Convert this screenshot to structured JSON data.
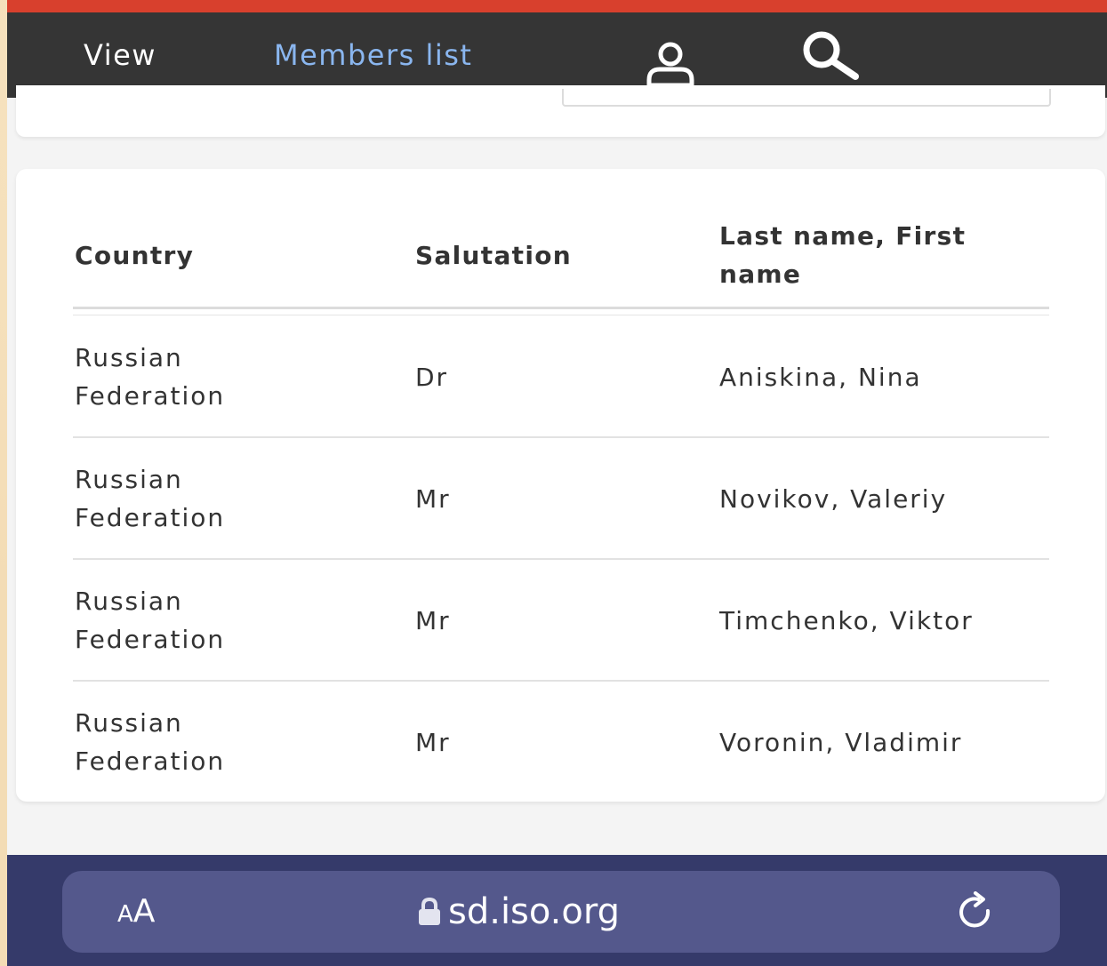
{
  "nav": {
    "tabs": [
      {
        "label": "View",
        "active": false
      },
      {
        "label": "Members list",
        "active": true
      }
    ],
    "icons": [
      "user-icon",
      "search-icon"
    ],
    "colors": {
      "bar": "#353535",
      "accent": "#8ab6ef",
      "top_strip": "#d8402d"
    }
  },
  "table": {
    "headers": [
      "Country",
      "Salutation",
      "Last name, First name"
    ],
    "rows": [
      {
        "country": "Russian Federation",
        "salutation": "Dr",
        "name": "Aniskina, Nina"
      },
      {
        "country": "Russian Federation",
        "salutation": "Mr",
        "name": "Novikov, Valeriy"
      },
      {
        "country": "Russian Federation",
        "salutation": "Mr",
        "name": "Timchenko, Viktor"
      },
      {
        "country": "Russian Federation",
        "salutation": "Mr",
        "name": "Voronin, Vladimir"
      }
    ]
  },
  "browser": {
    "text_size_label_small": "A",
    "text_size_label_large": "A",
    "url": "sd.iso.org",
    "icons": [
      "lock-icon",
      "reload-icon"
    ],
    "colors": {
      "bar": "#353a6a",
      "pill": "#54588c"
    }
  }
}
